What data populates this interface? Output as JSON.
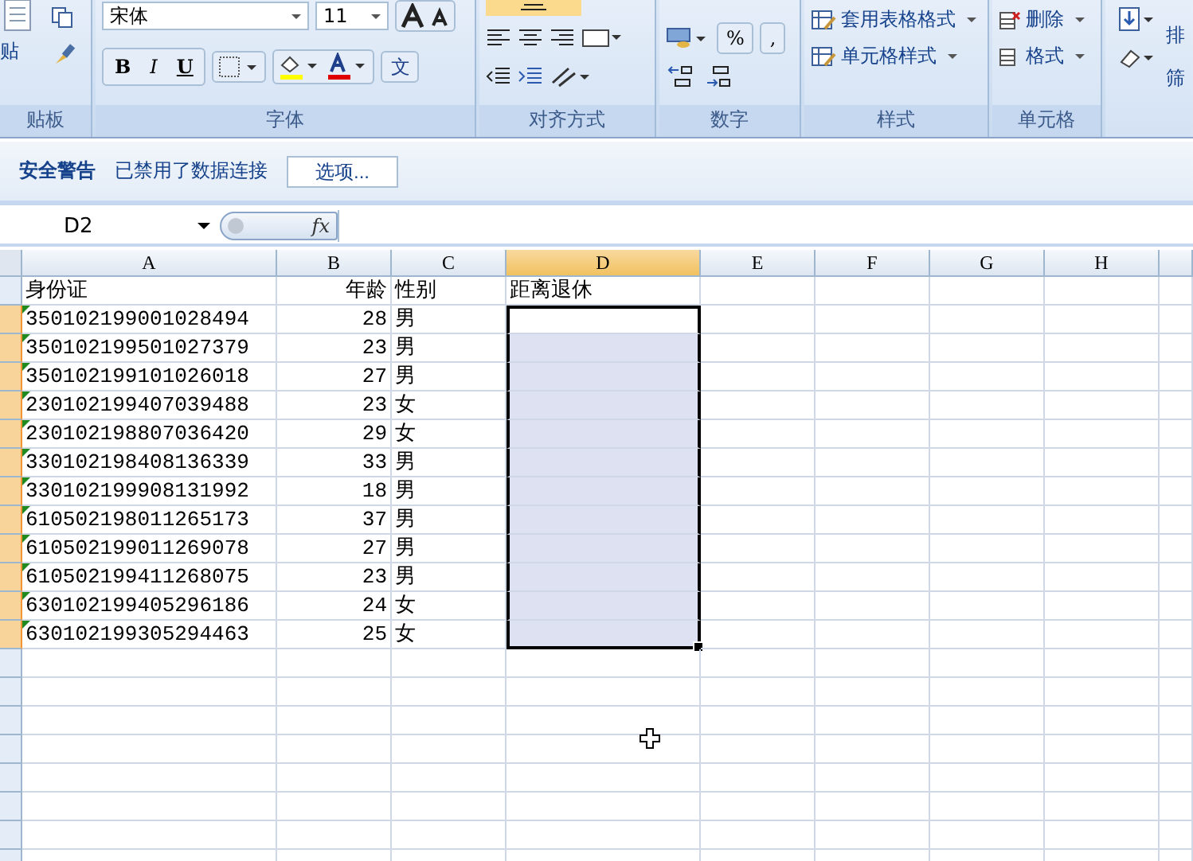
{
  "ribbon": {
    "clipboard": {
      "paste_label": "贴",
      "group_label": "贴板"
    },
    "font": {
      "font_name": "宋体",
      "font_size": "11",
      "bold": "B",
      "italic": "I",
      "underline": "U",
      "phonetic": "文",
      "group_label": "字体"
    },
    "alignment": {
      "group_label": "对齐方式"
    },
    "number": {
      "percent": "%",
      "comma": ",",
      "group_label": "数字"
    },
    "styles": {
      "items": [
        "套用表格格式",
        "单元格样式"
      ],
      "group_label": "样式"
    },
    "cells": {
      "items": [
        "删除",
        "格式"
      ],
      "group_label": "单元格"
    },
    "editing": {
      "items": [
        "排",
        "筛"
      ]
    }
  },
  "security_bar": {
    "title": "安全警告",
    "message": "已禁用了数据连接",
    "button": "选项..."
  },
  "formula_bar": {
    "name_box": "D2",
    "fx": "fx"
  },
  "sheet": {
    "columns": [
      {
        "label": "A",
        "selected": false
      },
      {
        "label": "B",
        "selected": false
      },
      {
        "label": "C",
        "selected": false
      },
      {
        "label": "D",
        "selected": true
      },
      {
        "label": "E",
        "selected": false
      },
      {
        "label": "F",
        "selected": false
      },
      {
        "label": "G",
        "selected": false
      },
      {
        "label": "H",
        "selected": false
      }
    ],
    "rows": [
      {
        "selected": false,
        "flag": false,
        "cells": [
          "身份证",
          "年龄",
          "性别",
          "距离退休"
        ]
      },
      {
        "selected": true,
        "flag": true,
        "active": true,
        "cells": [
          "350102199001028494",
          "28",
          "男"
        ]
      },
      {
        "selected": true,
        "flag": true,
        "active": false,
        "cells": [
          "350102199501027379",
          "23",
          "男"
        ]
      },
      {
        "selected": true,
        "flag": true,
        "active": false,
        "cells": [
          "350102199101026018",
          "27",
          "男"
        ]
      },
      {
        "selected": true,
        "flag": true,
        "active": false,
        "cells": [
          "230102199407039488",
          "23",
          "女"
        ]
      },
      {
        "selected": true,
        "flag": true,
        "active": false,
        "cells": [
          "230102198807036420",
          "29",
          "女"
        ]
      },
      {
        "selected": true,
        "flag": true,
        "active": false,
        "cells": [
          "330102198408136339",
          "33",
          "男"
        ]
      },
      {
        "selected": true,
        "flag": true,
        "active": false,
        "cells": [
          "330102199908131992",
          "18",
          "男"
        ]
      },
      {
        "selected": true,
        "flag": true,
        "active": false,
        "cells": [
          "610502198011265173",
          "37",
          "男"
        ]
      },
      {
        "selected": true,
        "flag": true,
        "active": false,
        "cells": [
          "610502199011269078",
          "27",
          "男"
        ]
      },
      {
        "selected": true,
        "flag": true,
        "active": false,
        "cells": [
          "610502199411268075",
          "23",
          "男"
        ]
      },
      {
        "selected": true,
        "flag": true,
        "active": false,
        "cells": [
          "630102199405296186",
          "24",
          "女"
        ]
      },
      {
        "selected": true,
        "flag": true,
        "active": false,
        "cells": [
          "630102199305294463",
          "25",
          "女"
        ]
      }
    ]
  }
}
